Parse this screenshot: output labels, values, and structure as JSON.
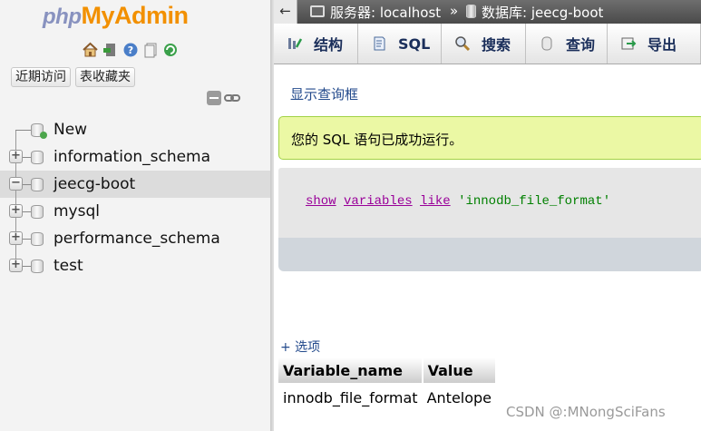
{
  "logo": {
    "part1": "php",
    "part2": "MyAdmin"
  },
  "nav": {
    "icons": [
      "home-icon",
      "exit-icon",
      "help-icon",
      "docs-icon",
      "reload-icon"
    ],
    "recent_label": "近期访问",
    "favorites_label": "表收藏夹",
    "tree": [
      {
        "name": "New",
        "kind": "new"
      },
      {
        "name": "information_schema",
        "kind": "db"
      },
      {
        "name": "jeecg-boot",
        "kind": "db",
        "expanded": true
      },
      {
        "name": "mysql",
        "kind": "db"
      },
      {
        "name": "performance_schema",
        "kind": "db"
      },
      {
        "name": "test",
        "kind": "db"
      }
    ]
  },
  "breadcrumb": {
    "back": "←",
    "server": "服务器: localhost",
    "separator": "»",
    "database": "数据库: jeecg-boot"
  },
  "tabs": [
    {
      "label": "结构",
      "icon": "structure-icon"
    },
    {
      "label": "SQL",
      "icon": "sql-icon"
    },
    {
      "label": "搜索",
      "icon": "search-icon"
    },
    {
      "label": "查询",
      "icon": "query-icon"
    },
    {
      "label": "导出",
      "icon": "export-icon"
    }
  ],
  "show_query_link": "显示查询框",
  "success_message": "您的 SQL 语句已成功运行。",
  "sql": {
    "kw1": "show",
    "kw2": "variables",
    "kw3": "like",
    "literal": "'innodb_file_format'"
  },
  "options_link": "+ 选项",
  "result": {
    "columns": [
      "Variable_name",
      "Value"
    ],
    "rows": [
      [
        "innodb_file_format",
        "Antelope"
      ]
    ]
  },
  "watermark": "CSDN @:MNongSciFans",
  "colors": {
    "success_bg": "#ebf8a4",
    "logo_orange": "#f29000",
    "link_blue": "#234a8c"
  }
}
